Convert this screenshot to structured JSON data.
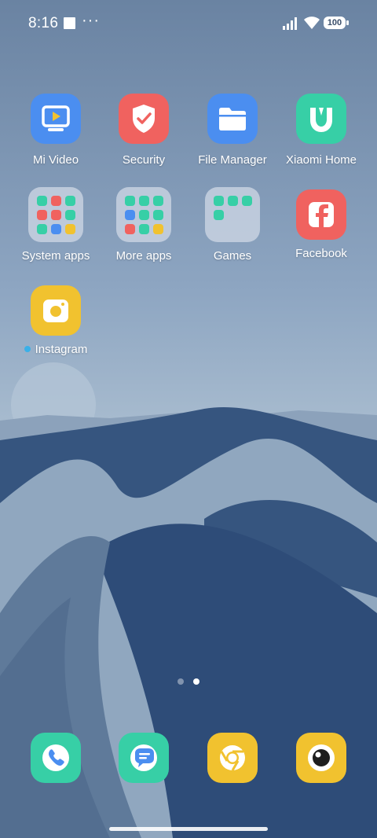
{
  "status_bar": {
    "time": "8:16",
    "overflow": "···",
    "battery": "100",
    "icons": [
      "screen-record-icon",
      "signal-icon",
      "wifi-icon",
      "battery-icon"
    ]
  },
  "home": {
    "row1": [
      {
        "label": "Mi Video",
        "color": "#4b8ef0"
      },
      {
        "label": "Security",
        "color": "#f0625f"
      },
      {
        "label": "File Manager",
        "color": "#4b8ef0"
      },
      {
        "label": "Xiaomi Home",
        "color": "#37cfa6"
      }
    ],
    "row2": [
      {
        "label": "System apps"
      },
      {
        "label": "More apps"
      },
      {
        "label": "Games"
      },
      {
        "label": "Facebook",
        "color": "#f0625f"
      }
    ],
    "row3": [
      {
        "label": "Instagram",
        "color": "#f1c22f",
        "new_indicator_color": "#3ab0e8"
      }
    ]
  },
  "page_indicator": {
    "pages": 2,
    "current": 2
  },
  "dock": [
    {
      "name": "Phone",
      "color": "#37cfa6"
    },
    {
      "name": "Messages",
      "color": "#37cfa6"
    },
    {
      "name": "Chrome",
      "color": "#f1c22f"
    },
    {
      "name": "Camera",
      "color": "#f1c22f"
    }
  ]
}
